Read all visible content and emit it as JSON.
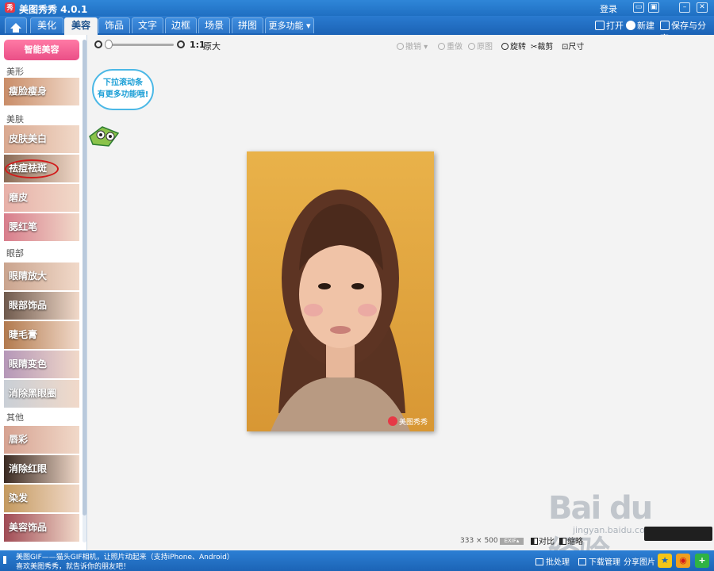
{
  "app": {
    "title": "美图秀秀 4.0.1",
    "logo_text": "秀",
    "login": "登录"
  },
  "window_controls": [
    {
      "name": "chat-icon",
      "glyph": "▭"
    },
    {
      "name": "settings-icon",
      "glyph": "▣"
    },
    {
      "name": "minimize-icon",
      "glyph": "–"
    },
    {
      "name": "close-icon",
      "glyph": "✕"
    }
  ],
  "menu": {
    "tabs": [
      "美化",
      "美容",
      "饰品",
      "文字",
      "边框",
      "场景",
      "拼图",
      "更多功能 ▾"
    ],
    "active_tab": "美容",
    "open_label": "打开",
    "new_label": "新建",
    "save_share_label": "保存与分享"
  },
  "left_panel": {
    "smart_button": "智能美容",
    "sections": {
      "shape": "美形",
      "skin": "美肤",
      "eyes": "眼部",
      "other": "其他"
    },
    "features": [
      {
        "label": "瘦脸瘦身",
        "color": "#c98d68"
      },
      {
        "label": "皮肤美白",
        "color": "#d9a88f"
      },
      {
        "label": "祛痘祛斑",
        "color": "#8a6a55"
      },
      {
        "label": "磨皮",
        "color": "#e7b0a8"
      },
      {
        "label": "腮红笔",
        "color": "#d87d8c"
      },
      {
        "label": "眼睛放大",
        "color": "#caa48e"
      },
      {
        "label": "眼部饰品",
        "color": "#6f5a4d"
      },
      {
        "label": "睫毛膏",
        "color": "#b27a4e"
      },
      {
        "label": "眼睛变色",
        "color": "#b597b8"
      },
      {
        "label": "消除黑眼圈",
        "color": "#c9cfd6"
      },
      {
        "label": "唇彩",
        "color": "#d6a291"
      },
      {
        "label": "消除红眼",
        "color": "#3a2a22"
      },
      {
        "label": "染发",
        "color": "#c49a5f"
      },
      {
        "label": "美容饰品",
        "color": "#a04b55"
      }
    ]
  },
  "canvas": {
    "zoom_ratio": "1:1",
    "zoom_label": "原大",
    "undo": "撤销",
    "redo": "重做",
    "original": "原图",
    "rotate": "旋转",
    "crop": "裁剪",
    "size": "尺寸",
    "tip": "下拉滚动条有更多功能哦!",
    "tip_line1": "下拉滚动条",
    "tip_line2": "有更多功能哦!",
    "photo_watermark": "美图秀秀",
    "dimensions": "333 × 500",
    "exif": "EXIF▴",
    "compare": "对比",
    "shrink": "缩略",
    "site_watermark": "Bai du 经验",
    "site_sub": "jingyan.baidu.com"
  },
  "statusbar": {
    "news_line1": "美图GIF——猫头GIF相机，让照片动起来（支持iPhone、Android）",
    "news_line2": "喜欢美图秀秀，就告诉你的朋友吧！",
    "batch": "批处理",
    "download": "下载管理",
    "share": "分享图片"
  },
  "colors": {
    "brand_blue": "#1f6fc2",
    "active_tab_text": "#1b4f8a",
    "smart_pink": "#ea4f87",
    "highlight_red": "#d11a1a"
  }
}
